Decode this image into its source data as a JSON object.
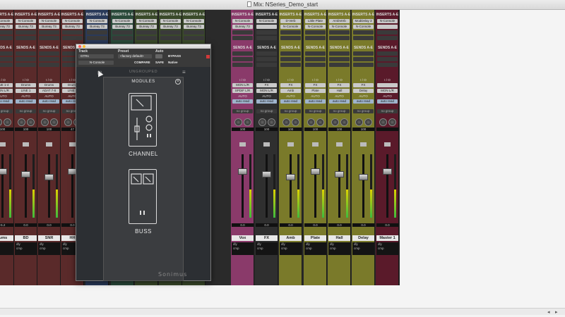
{
  "window": {
    "title": "Mix: NSeries_Demo_start"
  },
  "mixer": {
    "inserts_header": "INSERTS A-E",
    "sends_header": "SENDS A-E",
    "io_label": "I / O",
    "auto_label": "AUTO",
    "group_label": "no group",
    "strips": [
      {
        "name": "rums",
        "color": "#5a2a2a",
        "insert1": "N-Console",
        "insert2": "Bureay 73",
        "input": "MON L/R",
        "vol": "-5.2",
        "pan": "100",
        "dyn": "dly",
        "cmp": "cmp",
        "auto": "auto read",
        "io": "LINE 1-4"
      },
      {
        "name": "BD",
        "color": "#5a2a2a",
        "insert1": "N-Console",
        "insert2": "Bureay 73",
        "input": "LINE 1",
        "vol": "0.0",
        "pan": "100",
        "dyn": "dly",
        "cmp": "cmp",
        "auto": "auto read",
        "io": "Drums"
      },
      {
        "name": "SNR",
        "color": "#5a2a2a",
        "insert1": "N-Console",
        "insert2": "Bureay 73",
        "input": "ADAT 7-8",
        "vol": "0.0",
        "pan": "100",
        "dyn": "dly",
        "cmp": "cmp",
        "auto": "auto read",
        "io": "Drums"
      },
      {
        "name": "HH",
        "color": "#5a2a2a",
        "insert1": "N-Console",
        "insert2": "Bureay 73",
        "input": "LINE 5",
        "vol": "0.0",
        "pan": "47",
        "dyn": "dly",
        "cmp": "cmp",
        "auto": "auto read",
        "io": "Drums"
      },
      {
        "name": "",
        "color": "#2a3a5a",
        "insert1": "N-Console",
        "insert2": "Bureay 73",
        "input": "",
        "vol": "",
        "pan": "",
        "dyn": "",
        "cmp": "",
        "auto": "",
        "io": ""
      },
      {
        "name": "",
        "color": "#2a4a3a",
        "insert1": "N-Console",
        "insert2": "Bureay 73",
        "input": "",
        "vol": "",
        "pan": "",
        "dyn": "",
        "cmp": "",
        "auto": "",
        "io": ""
      },
      {
        "name": "",
        "color": "#3a4a2a",
        "insert1": "N-Console",
        "insert2": "Bureay 73",
        "input": "",
        "vol": "",
        "pan": "",
        "dyn": "",
        "cmp": "",
        "auto": "",
        "io": ""
      },
      {
        "name": "",
        "color": "#3a4a2a",
        "insert1": "N-Console",
        "insert2": "Bureay 73",
        "input": "",
        "vol": "",
        "pan": "",
        "dyn": "",
        "cmp": "",
        "auto": "",
        "io": ""
      },
      {
        "name": "devGTR2",
        "color": "#3a4a2a",
        "insert1": "N-Console",
        "insert2": "Bureay 73",
        "input": "GTRs",
        "vol": "0.0",
        "pan": "6",
        "dyn": "dly",
        "cmp": "cmp",
        "auto": "auto read",
        "io": "MON L/R"
      },
      {
        "name": "Vox",
        "color": "#8a3a6a",
        "insert1": "N-Console",
        "insert2": "Bureay 73",
        "input": "SPDIF L/R",
        "vol": "0.0",
        "pan": "100",
        "dyn": "dly",
        "cmp": "cmp",
        "auto": "auto read",
        "io": "MON L/R"
      },
      {
        "name": "FX",
        "color": "#2f2f2f",
        "insert1": "N-Console",
        "insert2": "",
        "input": "MON L/R",
        "vol": "0.0",
        "pan": "100",
        "dyn": "dly",
        "cmp": "cmp",
        "auto": "auto read",
        "io": "FX"
      },
      {
        "name": "Amb",
        "color": "#7a7a2a",
        "insert1": "D-Verb",
        "insert2": "N-Console",
        "input": "Amb",
        "vol": "0.0",
        "pan": "100",
        "dyn": "dly",
        "cmp": "cmp",
        "auto": "auto read",
        "io": "FX"
      },
      {
        "name": "Plate",
        "color": "#7a7a2a",
        "insert1": "Little Plate",
        "insert2": "N-Console",
        "input": "Plate",
        "vol": "0.0",
        "pan": "100",
        "dyn": "dly",
        "cmp": "cmp",
        "auto": "auto read",
        "io": "FX"
      },
      {
        "name": "Hall",
        "color": "#7a7a2a",
        "insert1": "AmbVerb",
        "insert2": "N-Console",
        "input": "Hall",
        "vol": "0.0",
        "pan": "100",
        "dyn": "dly",
        "cmp": "cmp",
        "auto": "auto read",
        "io": "FX"
      },
      {
        "name": "Delay",
        "color": "#7a7a2a",
        "insert1": "ModDelay 3",
        "insert2": "N-Console",
        "input": "Delay",
        "vol": "0.0",
        "pan": "100",
        "dyn": "dly",
        "cmp": "cmp",
        "auto": "auto read",
        "io": "FX"
      },
      {
        "name": "Master 1",
        "color": "#5a1a2a",
        "insert1": "N-Console",
        "insert2": "",
        "input": "MON L/R",
        "vol": "0.0",
        "pan": "",
        "dyn": "dly",
        "cmp": "cmp",
        "auto": "auto read",
        "io": ""
      }
    ]
  },
  "plugin": {
    "track_label": "Track",
    "track_value": "GTRs",
    "preset_label": "Preset",
    "preset_value": "<factory default>",
    "auto_label": "Auto",
    "plugin_name": "N-Console",
    "compare_label": "COMPARE",
    "bypass_label": "BYPASS",
    "safe_label": "SAFE",
    "native_label": "Native",
    "ungrouped_label": "UNGROUPED",
    "modules_title": "MODULES",
    "channel_label": "CHANNEL",
    "buss_label": "BUSS",
    "brand": "Sonimus"
  },
  "colors": {
    "accent_red": "#d23a3a",
    "meter_green": "#3dbb3d",
    "meter_yellow": "#ddd200"
  }
}
